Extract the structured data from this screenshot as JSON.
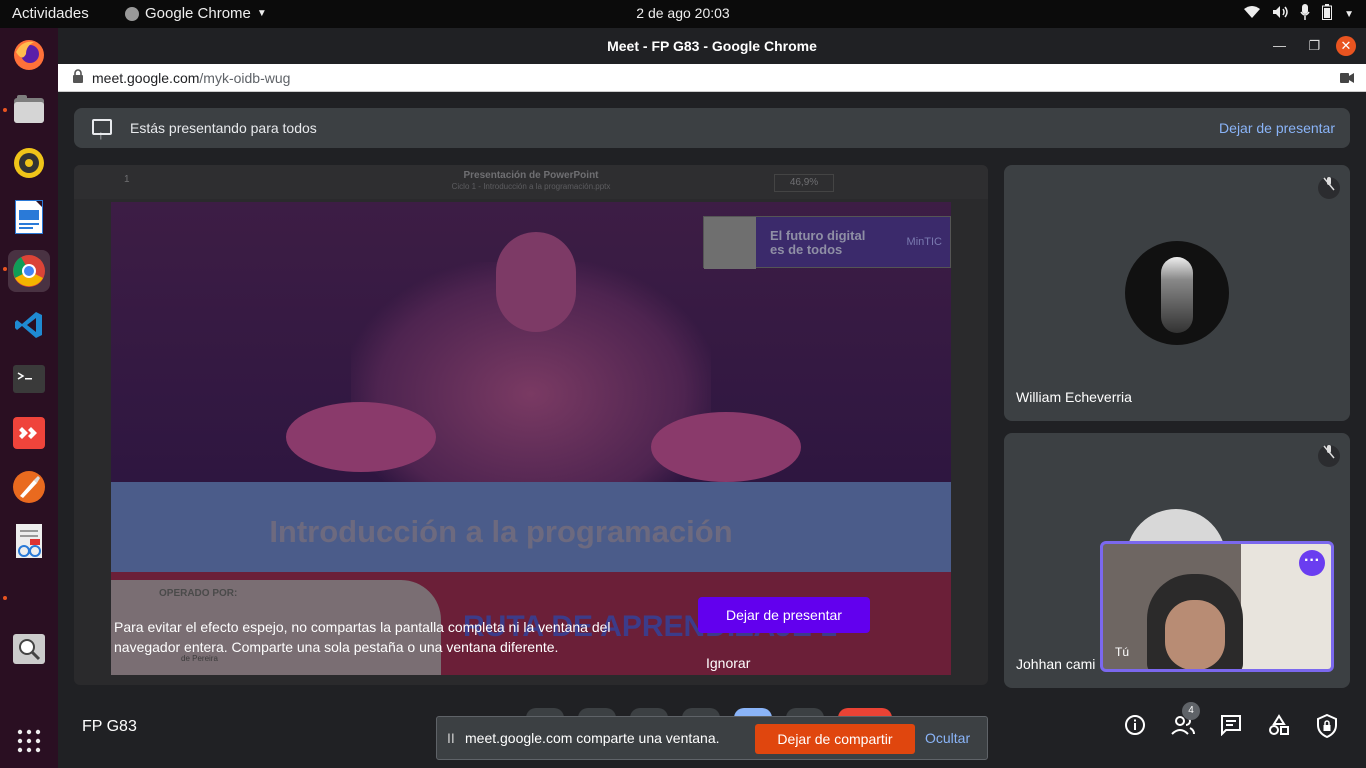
{
  "topbar": {
    "activities": "Actividades",
    "app_name": "Google Chrome",
    "clock": "2 de ago  20:03"
  },
  "dock": {
    "icons": [
      "firefox-icon",
      "files-icon",
      "rhythmbox-icon",
      "writer-icon",
      "chrome-icon",
      "vscode-icon",
      "terminal-icon",
      "anydesk-icon",
      "inkscape-icon",
      "document-viewer-icon",
      "magnifier-icon",
      "app-grid-icon"
    ]
  },
  "window": {
    "title": "Meet - FP G83 - Google Chrome"
  },
  "urlbar": {
    "domain": "meet.google.com",
    "path": "/myk-oidb-wug"
  },
  "banner": {
    "text": "Estás presentando para todos",
    "stop_label": "Dejar de presentar"
  },
  "presentation": {
    "ppt_title": "Presentación de PowerPoint",
    "ppt_subtitle": "Ciclo 1 - Introducción a la programación.pptx",
    "page": "1",
    "zoom": "46,9%",
    "slide_logo_text": "El futuro digital es de todos",
    "slide_logo_brand": "MinTIC",
    "slide_headline": "Introducción a la programación",
    "slide_operado": "OPERADO POR:",
    "slide_ruta": "RUTA DE APRENDIZAJE 1",
    "slide_pereira": "de Pereira"
  },
  "mirror_warning": {
    "message": "Para evitar el efecto espejo, no compartas la pantalla completa ni la ventana del navegador entera. Comparte una sola pestaña o una ventana diferente.",
    "stop_button": "Dejar de presentar",
    "ignore": "Ignorar"
  },
  "participants": [
    {
      "name": "William Echeverria"
    },
    {
      "name": "Johhan cami"
    }
  ],
  "self_view": {
    "label": "Tú"
  },
  "footer": {
    "meeting_name": "FP G83",
    "people_count": "4"
  },
  "sharebar": {
    "pause": "II",
    "message": "meet.google.com comparte una ventana.",
    "stop_label": "Dejar de compartir",
    "hide_label": "Ocultar"
  },
  "colors": {
    "accent_purple": "#6200ee",
    "stop_share": "#e0460e",
    "link_blue": "#8ab4f8",
    "dock_bg": "#2a0f22"
  }
}
